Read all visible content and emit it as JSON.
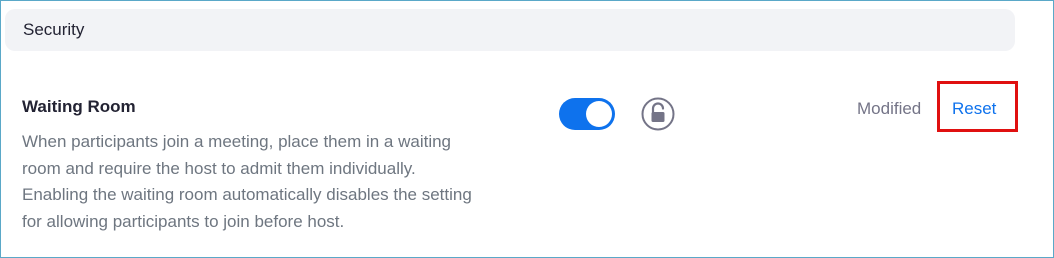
{
  "section": {
    "title": "Security"
  },
  "setting": {
    "title": "Waiting Room",
    "description_lines": [
      "When participants join a meeting, place them in a waiting",
      "room and require the host to admit them individually.",
      "Enabling the waiting room automatically disables the setting",
      "for allowing participants to join before host."
    ],
    "enabled": true,
    "lock_icon": "unlocked-padlock-icon",
    "status_label": "Modified",
    "reset_label": "Reset"
  },
  "colors": {
    "accent": "#0e72ed",
    "highlight_border": "#e01010"
  }
}
